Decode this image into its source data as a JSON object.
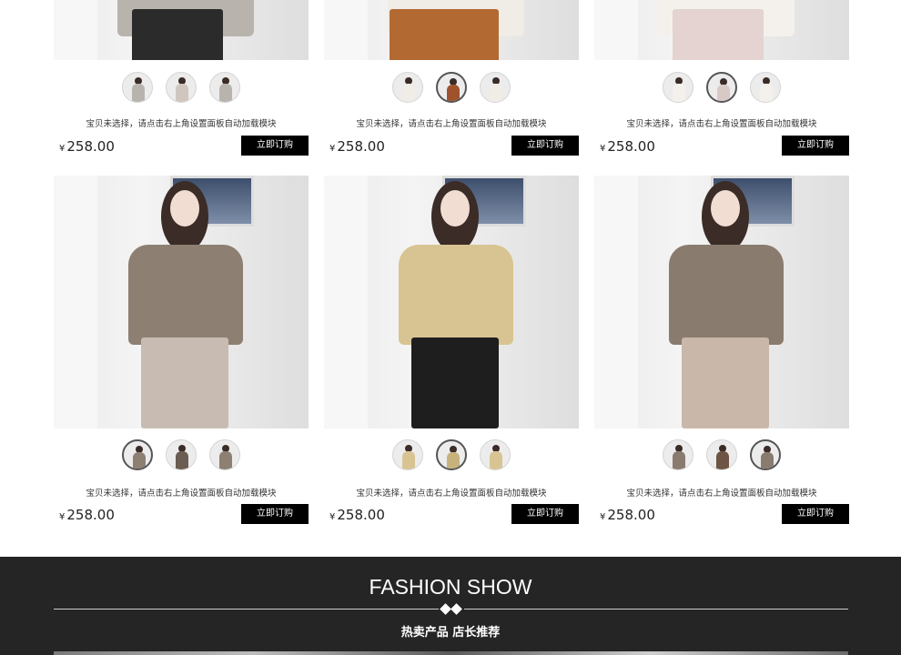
{
  "colors": {
    "button_bg": "#000000",
    "band_bg": "#252525",
    "text": "#333333"
  },
  "product_rows": [
    {
      "products": [
        {
          "caption": "宝贝未选择，请点击右上角设置面板自动加载模块",
          "currency": "¥",
          "price": "258.00",
          "buy_label": "立即订购",
          "swatch_count": 3,
          "active_swatch": null,
          "palette": {
            "top": "#b8b4ad",
            "bottom": "#2b2b2b",
            "accent": "#cfc7bf"
          }
        },
        {
          "caption": "宝贝未选择，请点击右上角设置面板自动加载模块",
          "currency": "¥",
          "price": "258.00",
          "buy_label": "立即订购",
          "swatch_count": 3,
          "active_swatch": 1,
          "palette": {
            "top": "#f0ece6",
            "bottom": "#b36a32",
            "accent": "#a0522d"
          }
        },
        {
          "caption": "宝贝未选择，请点击右上角设置面板自动加载模块",
          "currency": "¥",
          "price": "258.00",
          "buy_label": "立即订购",
          "swatch_count": 3,
          "active_swatch": 1,
          "palette": {
            "top": "#f4f1ec",
            "bottom": "#e4d3d0",
            "accent": "#d9c9c6"
          }
        }
      ]
    },
    {
      "products": [
        {
          "caption": "宝贝未选择，请点击右上角设置面板自动加载模块",
          "currency": "¥",
          "price": "258.00",
          "buy_label": "立即订购",
          "swatch_count": 3,
          "active_swatch": 0,
          "palette": {
            "top": "#8d7f72",
            "bottom": "#c8bcb2",
            "accent": "#6b5d52"
          }
        },
        {
          "caption": "宝贝未选择，请点击右上角设置面板自动加载模块",
          "currency": "¥",
          "price": "258.00",
          "buy_label": "立即订购",
          "swatch_count": 3,
          "active_swatch": 1,
          "palette": {
            "top": "#d8c493",
            "bottom": "#1e1e1e",
            "accent": "#c7b27c"
          }
        },
        {
          "caption": "宝贝未选择，请点击右上角设置面板自动加载模块",
          "currency": "¥",
          "price": "258.00",
          "buy_label": "立即订购",
          "swatch_count": 3,
          "active_swatch": 2,
          "palette": {
            "top": "#8a7b6f",
            "bottom": "#c9b8a9",
            "accent": "#6e5444"
          }
        }
      ]
    }
  ],
  "section": {
    "title": "FASHION SHOW",
    "subtitle": "热卖产品 店长推荐"
  }
}
